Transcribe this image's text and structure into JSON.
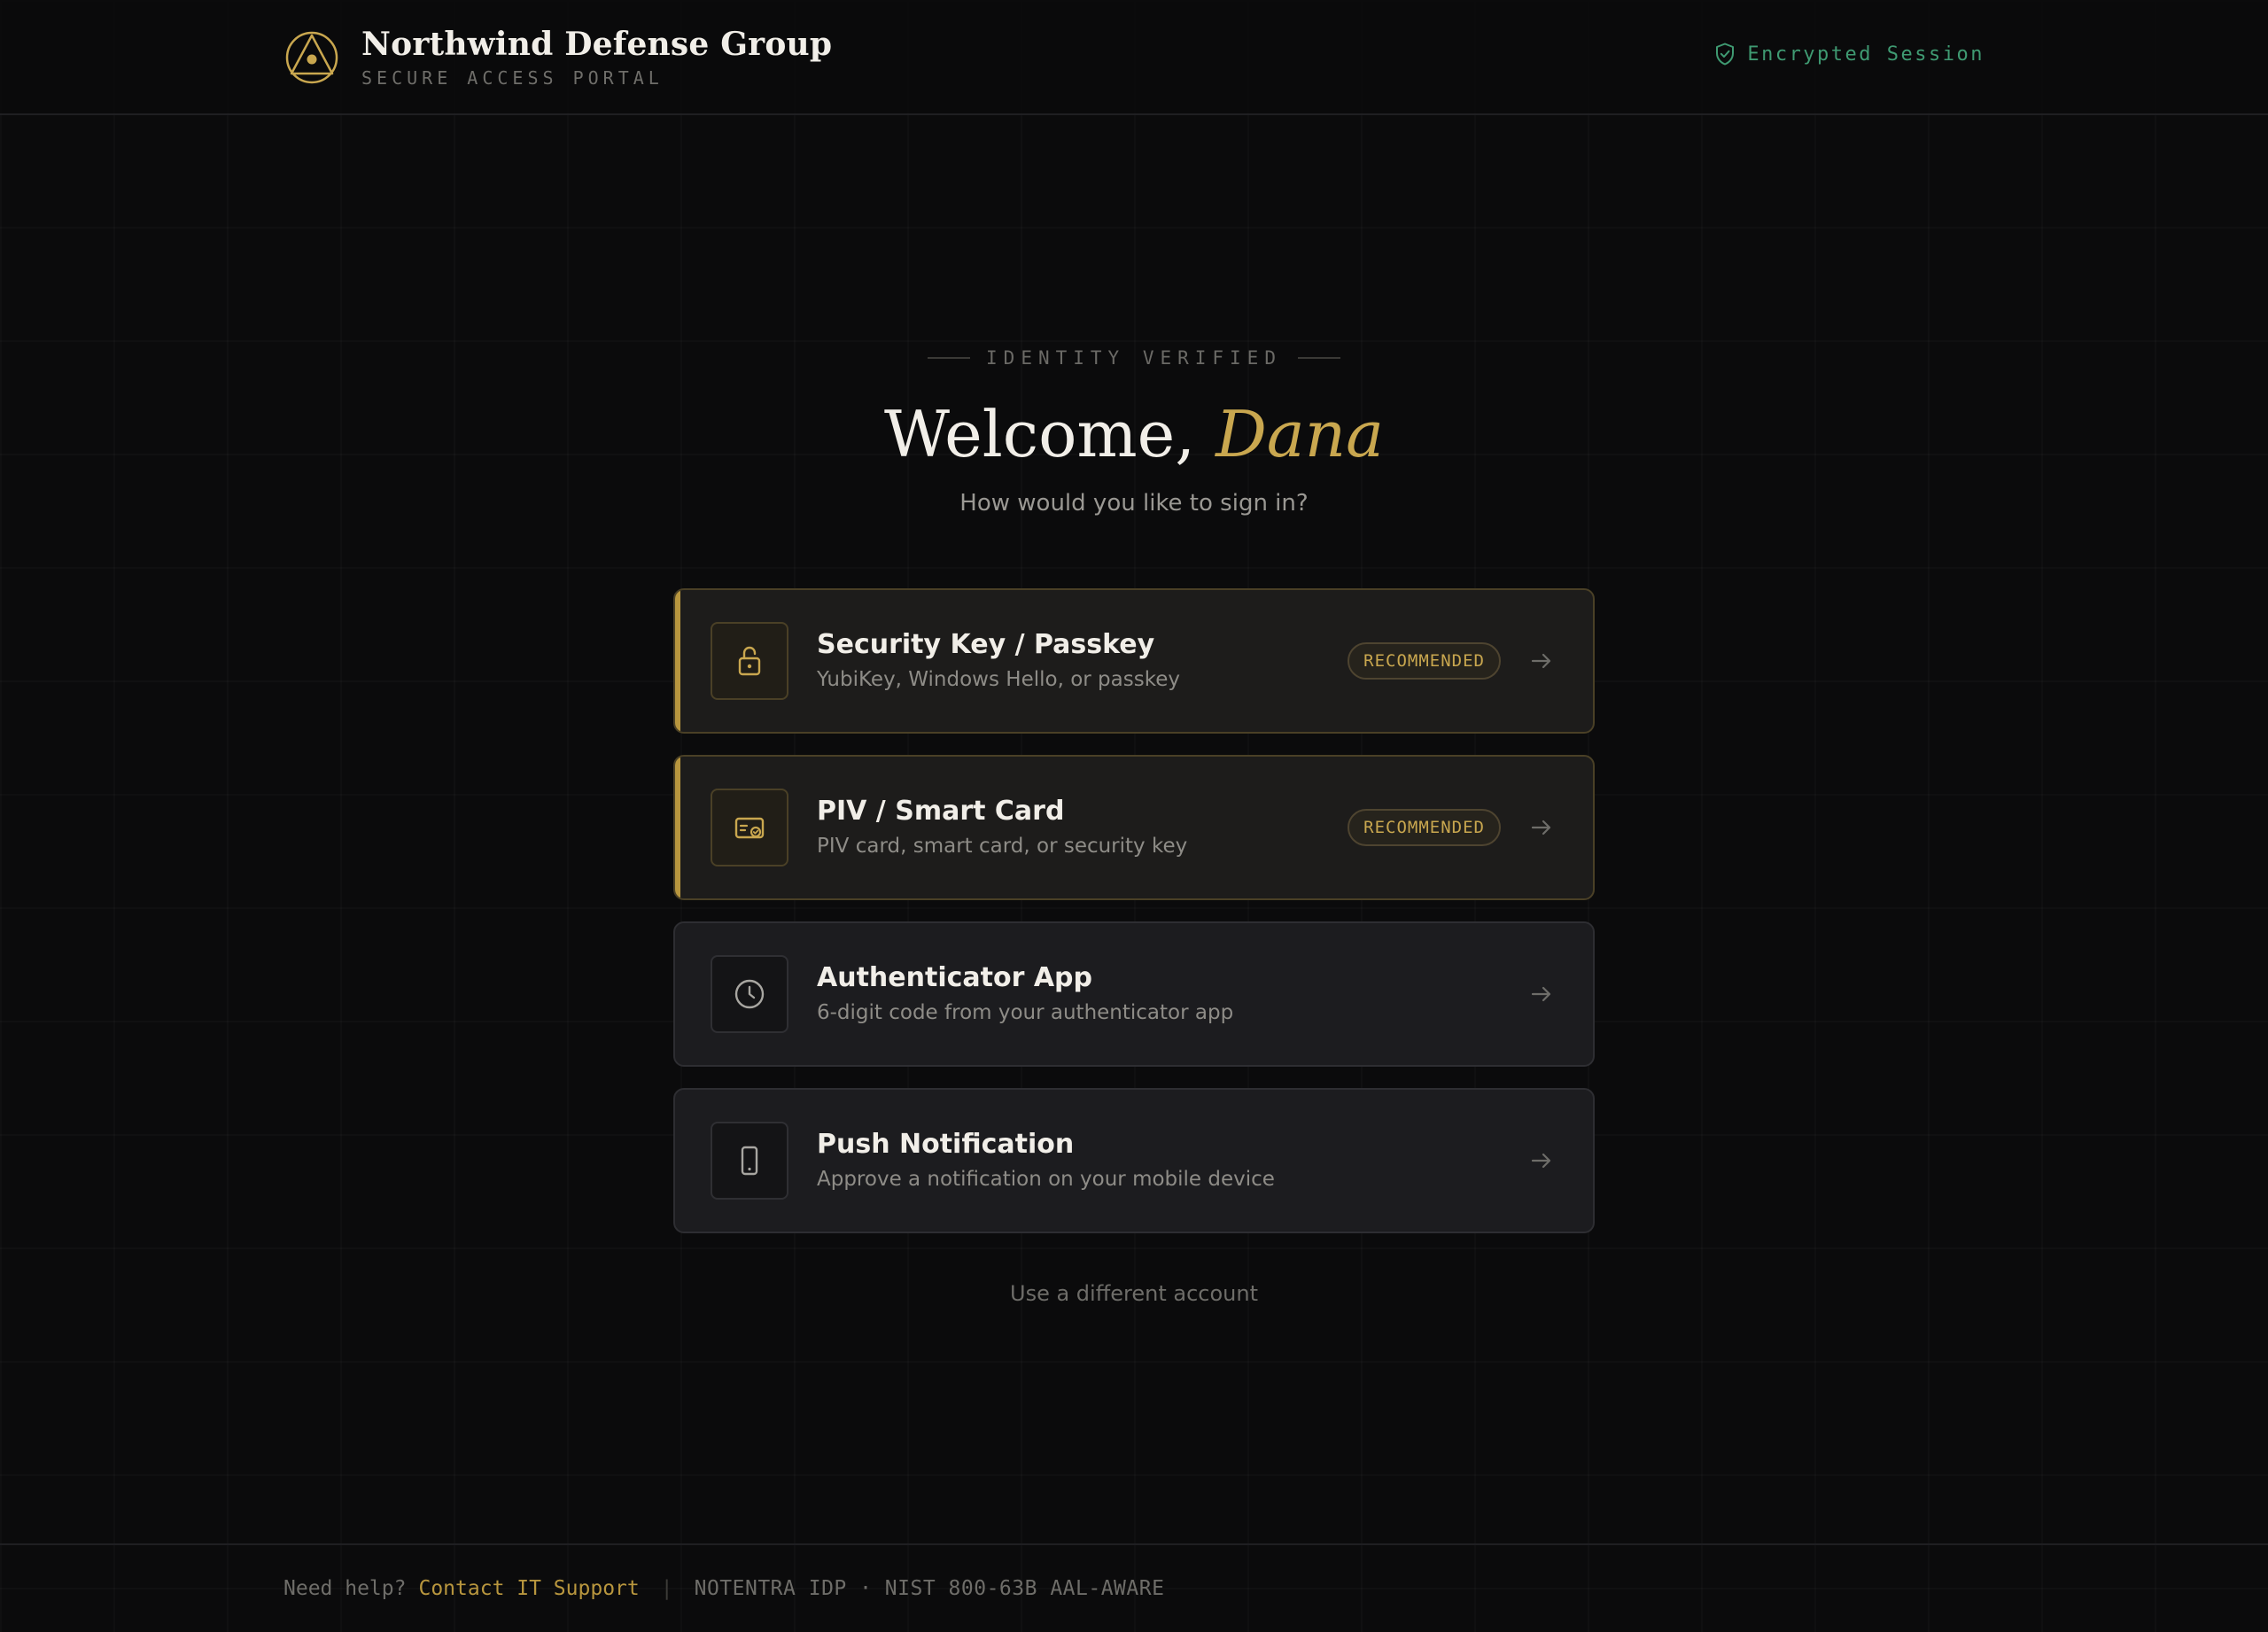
{
  "header": {
    "org_name": "Northwind Defense Group",
    "portal_label": "SECURE ACCESS PORTAL",
    "session_status": "Encrypted Session",
    "session_icon": "shield-check-icon",
    "logo_icon": "triangle-circle-logo"
  },
  "hero": {
    "eyebrow": "IDENTITY VERIFIED",
    "greeting": "Welcome,",
    "user_name": "Dana",
    "prompt": "How would you like to sign in?"
  },
  "options": [
    {
      "title": "Security Key / Passkey",
      "description": "YubiKey, Windows Hello, or passkey",
      "badge": "RECOMMENDED",
      "icon": "unlocked-padlock-icon"
    },
    {
      "title": "PIV / Smart Card",
      "description": "PIV card, smart card, or security key",
      "badge": "RECOMMENDED",
      "icon": "smart-card-icon"
    },
    {
      "title": "Authenticator App",
      "description": "6-digit code from your authenticator app",
      "badge": "",
      "icon": "clock-icon"
    },
    {
      "title": "Push Notification",
      "description": "Approve a notification on your mobile device",
      "badge": "",
      "icon": "mobile-phone-icon"
    }
  ],
  "alt_account_label": "Use a different account",
  "footer": {
    "help_text": "Need help?",
    "help_link": "Contact IT Support",
    "separator": "|",
    "meta": "NOTENTRA IDP · NIST 800-63B AAL-AWARE"
  },
  "colors": {
    "background": "#0b0b0c",
    "accent_gold": "#c9a74f",
    "session_green": "#3f9a72",
    "card_background": "#1c1c1f"
  }
}
